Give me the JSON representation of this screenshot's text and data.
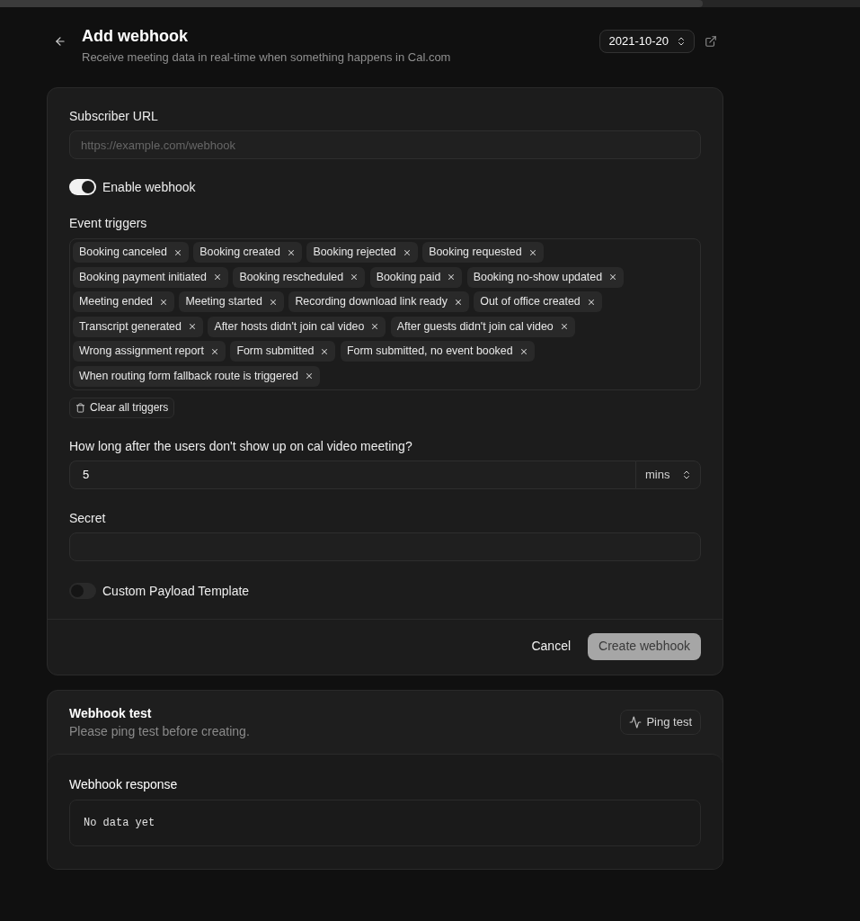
{
  "header": {
    "title": "Add webhook",
    "subtitle": "Receive meeting data in real-time when something happens in Cal.com",
    "version": "2021-10-20"
  },
  "form": {
    "subscriber_url": {
      "label": "Subscriber URL",
      "placeholder": "https://example.com/webhook"
    },
    "enable_toggle": {
      "label": "Enable webhook",
      "on": true
    },
    "event_triggers": {
      "label": "Event triggers",
      "items": [
        "Booking canceled",
        "Booking created",
        "Booking rejected",
        "Booking requested",
        "Booking payment initiated",
        "Booking rescheduled",
        "Booking paid",
        "Booking no-show updated",
        "Meeting ended",
        "Meeting started",
        "Recording download link ready",
        "Out of office created",
        "Transcript generated",
        "After hosts didn't join cal video",
        "After guests didn't join cal video",
        "Wrong assignment report",
        "Form submitted",
        "Form submitted, no event booked",
        "When routing form fallback route is triggered"
      ],
      "clear_button": "Clear all triggers"
    },
    "no_show_delay": {
      "label": "How long after the users don't show up on cal video meeting?",
      "value": "5",
      "unit": "mins"
    },
    "secret": {
      "label": "Secret"
    },
    "custom_payload_toggle": {
      "label": "Custom Payload Template",
      "on": false
    },
    "buttons": [
      {
        "label": "Cancel",
        "kind": "secondary",
        "disabled": false
      },
      {
        "label": "Create webhook",
        "kind": "primary",
        "disabled": true
      }
    ]
  },
  "webhook_test": {
    "title": "Webhook test",
    "subtitle": "Please ping test before creating.",
    "button": "Ping test",
    "response": {
      "title": "Webhook response",
      "text": "No data yet"
    }
  }
}
